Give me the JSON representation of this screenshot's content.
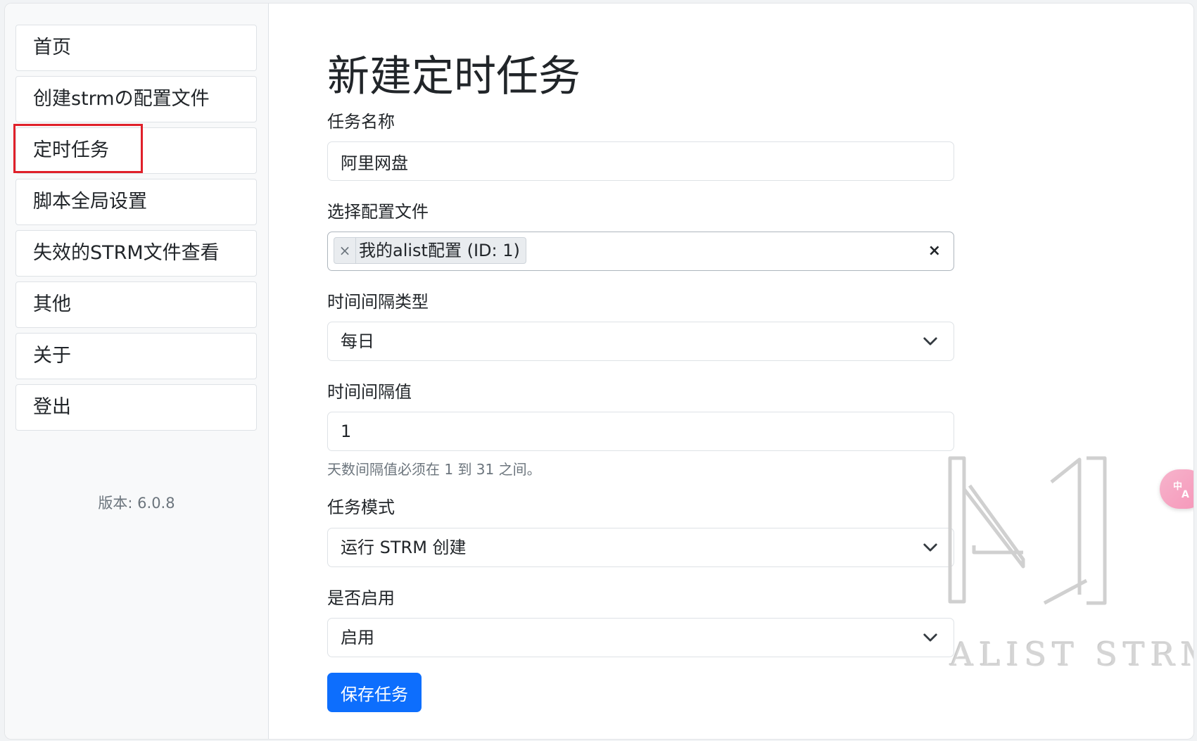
{
  "sidebar": {
    "items": [
      {
        "label": "首页"
      },
      {
        "label": "创建strmの配置文件"
      },
      {
        "label": "定时任务"
      },
      {
        "label": "脚本全局设置"
      },
      {
        "label": "失效的STRM文件查看"
      },
      {
        "label": "其他"
      },
      {
        "label": "关于"
      },
      {
        "label": "登出"
      }
    ],
    "active_item": "定时任务",
    "version": "版本: 6.0.8"
  },
  "form": {
    "title": "新建定时任务",
    "task_name": {
      "label": "任务名称",
      "value": "阿里网盘"
    },
    "config_file": {
      "label": "选择配置文件",
      "selected": [
        "我的alist配置 (ID: 1)"
      ],
      "tag_remove_glyph": "×",
      "clear_glyph": "×"
    },
    "interval_type": {
      "label": "时间间隔类型",
      "value": "每日"
    },
    "interval_value": {
      "label": "时间间隔值",
      "value": "1",
      "help": "天数间隔值必须在 1 到 31 之间。"
    },
    "task_mode": {
      "label": "任务模式",
      "value": "运行 STRM 创建"
    },
    "enabled": {
      "label": "是否启用",
      "value": "启用"
    },
    "save_label": "保存任务"
  },
  "watermark": {
    "text": "ALIST STRM"
  },
  "colors": {
    "primary": "#0d6efd",
    "highlight_box": "#e0202a",
    "sidebar_bg": "#f8f9fa",
    "fab": "#f595b8"
  },
  "icons": {
    "select_arrow": "chevron-down-icon",
    "translate": "translate-icon"
  }
}
